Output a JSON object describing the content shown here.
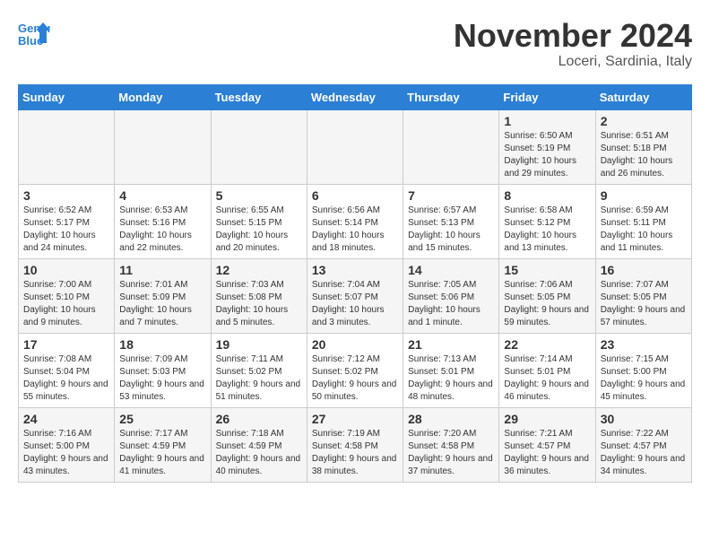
{
  "header": {
    "logo_line1": "General",
    "logo_line2": "Blue",
    "month": "November 2024",
    "location": "Loceri, Sardinia, Italy"
  },
  "columns": [
    "Sunday",
    "Monday",
    "Tuesday",
    "Wednesday",
    "Thursday",
    "Friday",
    "Saturday"
  ],
  "rows": [
    [
      {
        "day": "",
        "info": ""
      },
      {
        "day": "",
        "info": ""
      },
      {
        "day": "",
        "info": ""
      },
      {
        "day": "",
        "info": ""
      },
      {
        "day": "",
        "info": ""
      },
      {
        "day": "1",
        "info": "Sunrise: 6:50 AM\nSunset: 5:19 PM\nDaylight: 10 hours and 29 minutes."
      },
      {
        "day": "2",
        "info": "Sunrise: 6:51 AM\nSunset: 5:18 PM\nDaylight: 10 hours and 26 minutes."
      }
    ],
    [
      {
        "day": "3",
        "info": "Sunrise: 6:52 AM\nSunset: 5:17 PM\nDaylight: 10 hours and 24 minutes."
      },
      {
        "day": "4",
        "info": "Sunrise: 6:53 AM\nSunset: 5:16 PM\nDaylight: 10 hours and 22 minutes."
      },
      {
        "day": "5",
        "info": "Sunrise: 6:55 AM\nSunset: 5:15 PM\nDaylight: 10 hours and 20 minutes."
      },
      {
        "day": "6",
        "info": "Sunrise: 6:56 AM\nSunset: 5:14 PM\nDaylight: 10 hours and 18 minutes."
      },
      {
        "day": "7",
        "info": "Sunrise: 6:57 AM\nSunset: 5:13 PM\nDaylight: 10 hours and 15 minutes."
      },
      {
        "day": "8",
        "info": "Sunrise: 6:58 AM\nSunset: 5:12 PM\nDaylight: 10 hours and 13 minutes."
      },
      {
        "day": "9",
        "info": "Sunrise: 6:59 AM\nSunset: 5:11 PM\nDaylight: 10 hours and 11 minutes."
      }
    ],
    [
      {
        "day": "10",
        "info": "Sunrise: 7:00 AM\nSunset: 5:10 PM\nDaylight: 10 hours and 9 minutes."
      },
      {
        "day": "11",
        "info": "Sunrise: 7:01 AM\nSunset: 5:09 PM\nDaylight: 10 hours and 7 minutes."
      },
      {
        "day": "12",
        "info": "Sunrise: 7:03 AM\nSunset: 5:08 PM\nDaylight: 10 hours and 5 minutes."
      },
      {
        "day": "13",
        "info": "Sunrise: 7:04 AM\nSunset: 5:07 PM\nDaylight: 10 hours and 3 minutes."
      },
      {
        "day": "14",
        "info": "Sunrise: 7:05 AM\nSunset: 5:06 PM\nDaylight: 10 hours and 1 minute."
      },
      {
        "day": "15",
        "info": "Sunrise: 7:06 AM\nSunset: 5:05 PM\nDaylight: 9 hours and 59 minutes."
      },
      {
        "day": "16",
        "info": "Sunrise: 7:07 AM\nSunset: 5:05 PM\nDaylight: 9 hours and 57 minutes."
      }
    ],
    [
      {
        "day": "17",
        "info": "Sunrise: 7:08 AM\nSunset: 5:04 PM\nDaylight: 9 hours and 55 minutes."
      },
      {
        "day": "18",
        "info": "Sunrise: 7:09 AM\nSunset: 5:03 PM\nDaylight: 9 hours and 53 minutes."
      },
      {
        "day": "19",
        "info": "Sunrise: 7:11 AM\nSunset: 5:02 PM\nDaylight: 9 hours and 51 minutes."
      },
      {
        "day": "20",
        "info": "Sunrise: 7:12 AM\nSunset: 5:02 PM\nDaylight: 9 hours and 50 minutes."
      },
      {
        "day": "21",
        "info": "Sunrise: 7:13 AM\nSunset: 5:01 PM\nDaylight: 9 hours and 48 minutes."
      },
      {
        "day": "22",
        "info": "Sunrise: 7:14 AM\nSunset: 5:01 PM\nDaylight: 9 hours and 46 minutes."
      },
      {
        "day": "23",
        "info": "Sunrise: 7:15 AM\nSunset: 5:00 PM\nDaylight: 9 hours and 45 minutes."
      }
    ],
    [
      {
        "day": "24",
        "info": "Sunrise: 7:16 AM\nSunset: 5:00 PM\nDaylight: 9 hours and 43 minutes."
      },
      {
        "day": "25",
        "info": "Sunrise: 7:17 AM\nSunset: 4:59 PM\nDaylight: 9 hours and 41 minutes."
      },
      {
        "day": "26",
        "info": "Sunrise: 7:18 AM\nSunset: 4:59 PM\nDaylight: 9 hours and 40 minutes."
      },
      {
        "day": "27",
        "info": "Sunrise: 7:19 AM\nSunset: 4:58 PM\nDaylight: 9 hours and 38 minutes."
      },
      {
        "day": "28",
        "info": "Sunrise: 7:20 AM\nSunset: 4:58 PM\nDaylight: 9 hours and 37 minutes."
      },
      {
        "day": "29",
        "info": "Sunrise: 7:21 AM\nSunset: 4:57 PM\nDaylight: 9 hours and 36 minutes."
      },
      {
        "day": "30",
        "info": "Sunrise: 7:22 AM\nSunset: 4:57 PM\nDaylight: 9 hours and 34 minutes."
      }
    ]
  ]
}
